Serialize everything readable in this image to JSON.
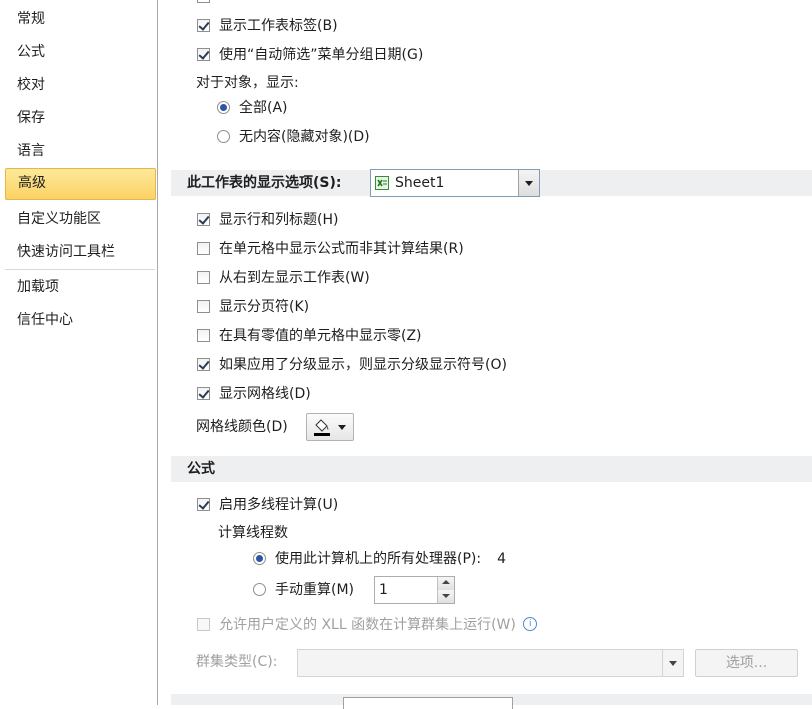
{
  "sidebar": {
    "items": [
      {
        "label": "常规"
      },
      {
        "label": "公式"
      },
      {
        "label": "校对"
      },
      {
        "label": "保存"
      },
      {
        "label": "语言"
      },
      {
        "label": "高级"
      },
      {
        "label": "自定义功能区"
      },
      {
        "label": "快速访问工具栏"
      },
      {
        "label": "加载项"
      },
      {
        "label": "信任中心"
      }
    ],
    "active": "高级"
  },
  "display_workbook": {
    "show_sheet_tabs": {
      "label": "显示工作表标签(B)",
      "checked": true
    },
    "group_dates": {
      "label": "使用“自动筛选”菜单分组日期(G)",
      "checked": true
    },
    "objects_label": "对于对象，显示:",
    "objects_all": {
      "label": "全部(A)",
      "selected": true
    },
    "objects_none": {
      "label": "无内容(隐藏对象)(D)",
      "selected": false
    }
  },
  "sheet_options": {
    "header": "此工作表的显示选项(S):",
    "sheet_select": "Sheet1",
    "show_headers": {
      "label": "显示行和列标题(H)",
      "checked": true
    },
    "show_formulas": {
      "label": "在单元格中显示公式而非其计算结果(R)",
      "checked": false
    },
    "right_to_left": {
      "label": "从右到左显示工作表(W)",
      "checked": false
    },
    "show_page_breaks": {
      "label": "显示分页符(K)",
      "checked": false
    },
    "show_zeros": {
      "label": "在具有零值的单元格中显示零(Z)",
      "checked": false
    },
    "outline_symbols": {
      "label": "如果应用了分级显示，则显示分级显示符号(O)",
      "checked": true
    },
    "show_gridlines": {
      "label": "显示网格线(D)",
      "checked": true
    },
    "gridline_color_label": "网格线颜色(D)"
  },
  "formulas": {
    "header": "公式",
    "multithread": {
      "label": "启用多线程计算(U)",
      "checked": true
    },
    "threads_label": "计算线程数",
    "use_all": {
      "label": "使用此计算机上的所有处理器(P):",
      "value": "4",
      "selected": true
    },
    "manual": {
      "label": "手动重算(M)",
      "value": "1",
      "selected": false
    },
    "xll": {
      "label": "允许用户定义的 XLL 函数在计算群集上运行(W)",
      "checked": false
    },
    "cluster_type_label": "群集类型(C):",
    "options_button": "选项..."
  },
  "colors": {
    "accent": "#fbd264",
    "section_band": "#eeeff1",
    "radio_dot": "#2b55a5"
  }
}
